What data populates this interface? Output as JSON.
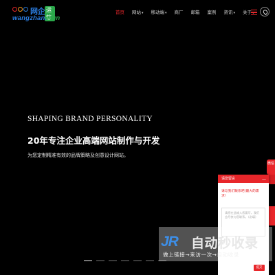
{
  "header": {
    "logo": {
      "cn_text": "网企",
      "badge": "运营",
      "en_text_main": "wangzhan.",
      "en_text_tail": "Run"
    },
    "nav": [
      {
        "label": "首页",
        "active": true,
        "dropdown": false
      },
      {
        "label": "网站",
        "active": false,
        "dropdown": true
      },
      {
        "label": "移动端",
        "active": false,
        "dropdown": true
      },
      {
        "label": "商厂",
        "active": false,
        "dropdown": false
      },
      {
        "label": "邮箱",
        "active": false,
        "dropdown": false
      },
      {
        "label": "案例",
        "active": false,
        "dropdown": false
      },
      {
        "label": "资讯",
        "active": false,
        "dropdown": true
      },
      {
        "label": "关于",
        "active": false,
        "dropdown": true
      }
    ],
    "icons": {
      "menu": "hamburger-menu-icon",
      "location": "location-pin-icon"
    }
  },
  "hero": {
    "title_en": "SHAPING BRAND PERSONALITY",
    "title_cn": "20年专注企业高端网站制作与开发",
    "subtitle": "为您定制精准有效的品牌策略及创意设计网站。"
  },
  "slider": {
    "slide_count": 7,
    "active_index": 0
  },
  "side_tabs": [
    {
      "label": "微信"
    },
    {
      "label": ""
    },
    {
      "label": ""
    }
  ],
  "message_panel": {
    "title": "请您留言",
    "greeting": "请与我们联系吧(最大的需求！",
    "placeholder": "请您在此输入您要写，我们会尽快与您联系。（必填）",
    "send_label": "提交"
  },
  "watermark": {
    "logo": "JR",
    "title": "自动秒收录",
    "subtitle": "做上链接→来访一次→自动收录"
  },
  "colors": {
    "accent": "#e8262a",
    "brand_blue": "#2b7de0",
    "background": "#000000"
  }
}
